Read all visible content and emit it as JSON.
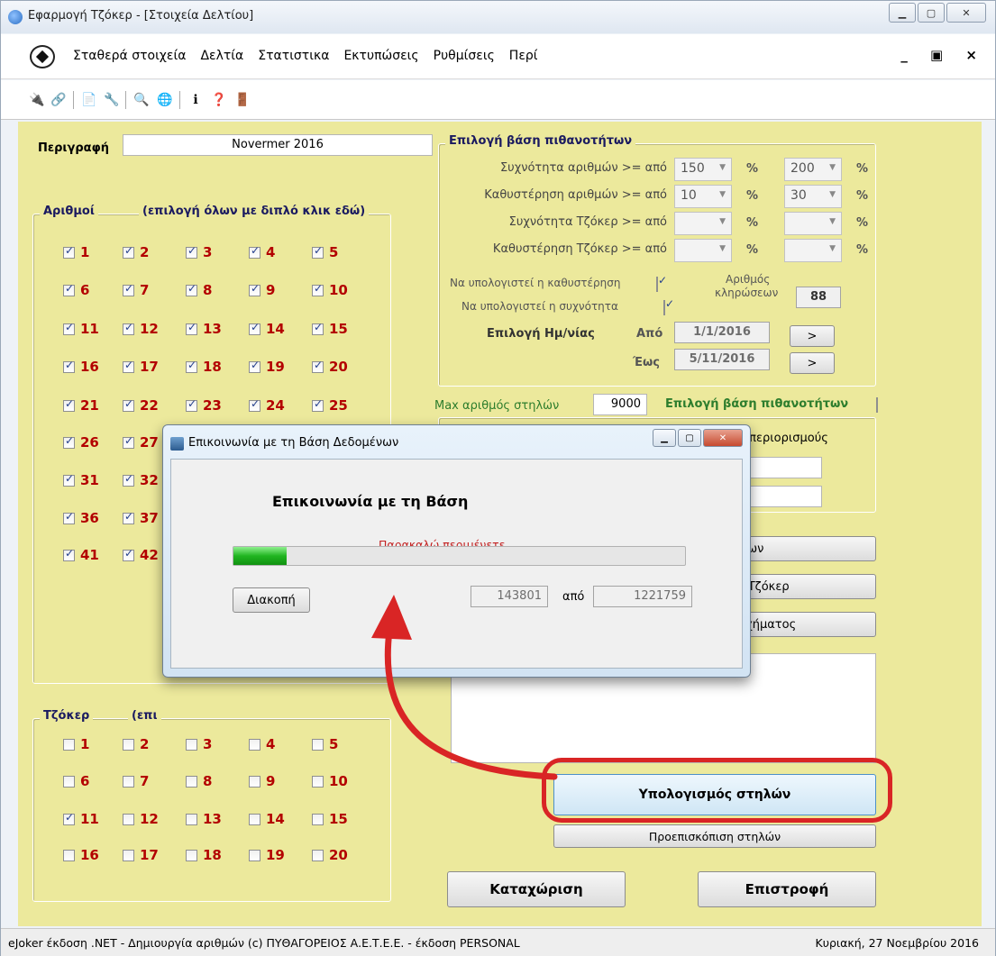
{
  "window": {
    "title": "Εφαρμογή Τζόκερ - [Στοιχεία Δελτίου]"
  },
  "menu": [
    "Σταθερά στοιχεία",
    "Δελτία",
    "Στατιστικα",
    "Εκτυπώσεις",
    "Ρυθμίσεις",
    "Περί"
  ],
  "toolbar_icons": [
    "connect-icon",
    "link-icon",
    "report-icon",
    "tools-icon",
    "search-icon",
    "web-icon",
    "info-icon",
    "help-icon",
    "exit-icon"
  ],
  "form": {
    "description_label": "Περιγραφή",
    "description_value": "Novermer 2016",
    "numbers_group": "Αριθμοί",
    "numbers_hint": "(επιλογή όλων με διπλό κλικ εδώ)",
    "jokers_group": "Τζόκερ",
    "jokers_hint_partial": "(επι",
    "max_columns_label": "Max αριθμός στηλών",
    "max_columns_value": "9000",
    "prob_select_label": "Επιλογή βάση πιθανοτήτων",
    "restrictions_partial": "ε περιορισμούς",
    "btn1_partial": "ρων",
    "btn2_partial": "α Τζόκερ",
    "btn3_partial": "Σχήματος",
    "calc_button": "Υπολογισμός στηλών",
    "preview_button": "Προεπισκόπιση στηλών",
    "submit_button": "Καταχώριση",
    "return_button": "Επιστροφή"
  },
  "probability_group": {
    "title": "Επιλογή βάση πιθανοτήτων",
    "rows": [
      {
        "label": "Συχνότητα αριθμών >= από",
        "from": "150",
        "to": "200"
      },
      {
        "label": "Καθυστέρηση αριθμών >= από",
        "from": "10",
        "to": "30"
      },
      {
        "label": "Συχνότητα Τζόκερ >= από",
        "from": "",
        "to": ""
      },
      {
        "label": "Καθυστέρηση Τζόκερ >= από",
        "from": "",
        "to": ""
      }
    ],
    "pct": "%",
    "calc_delay": "Να υπολογιστεί η καθυστέρηση",
    "calc_freq": "Να υπολογιστεί η συχνότητα",
    "draws_label_1": "Αριθμός",
    "draws_label_2": "κληρώσεων",
    "draws_value": "88",
    "date_label": "Επιλογή Ημ/νίας",
    "from_label": "Από",
    "to_label": "Έως",
    "from_date": "1/1/2016",
    "to_date": "5/11/2016",
    "arrow": ">"
  },
  "numbers": [
    [
      "1",
      "2",
      "3",
      "4",
      "5"
    ],
    [
      "6",
      "7",
      "8",
      "9",
      "10"
    ],
    [
      "11",
      "12",
      "13",
      "14",
      "15"
    ],
    [
      "16",
      "17",
      "18",
      "19",
      "20"
    ],
    [
      "21",
      "22",
      "23",
      "24",
      "25"
    ],
    [
      "26",
      "27"
    ],
    [
      "31",
      "32"
    ],
    [
      "36",
      "37"
    ],
    [
      "41",
      "42"
    ]
  ],
  "jokers": [
    [
      "1",
      "2",
      "3",
      "4",
      "5"
    ],
    [
      "6",
      "7",
      "8",
      "9",
      "10"
    ],
    [
      "11",
      "12",
      "13",
      "14",
      "15"
    ],
    [
      "16",
      "17",
      "18",
      "19",
      "20"
    ]
  ],
  "jokers_checked": [
    "11"
  ],
  "modal": {
    "title": "Επικοινωνία με τη Βάση Δεδομένων",
    "heading": "Επικοινωνία με τη Βάση",
    "wait_text": "Παρακαλώ περιμένετε ....",
    "cancel_button": "Διακοπή",
    "current": "143801",
    "of_label": "από",
    "total": "1221759",
    "progress_fraction": 0.118
  },
  "status": {
    "left": "eJoker έκδοση .NET - Δημιουργία αριθμών (c) ΠΥΘΑΓΟΡΕΙΟΣ Α.Ε.Τ.Ε.Ε. - έκδοση PERSONAL",
    "right": "Κυριακή, 27 Νοεμβρίου 2016"
  },
  "colors": {
    "panel": "#ece99c",
    "number_red": "#b30000",
    "highlight_red": "#d92525",
    "label_green": "#2d7d2d"
  }
}
